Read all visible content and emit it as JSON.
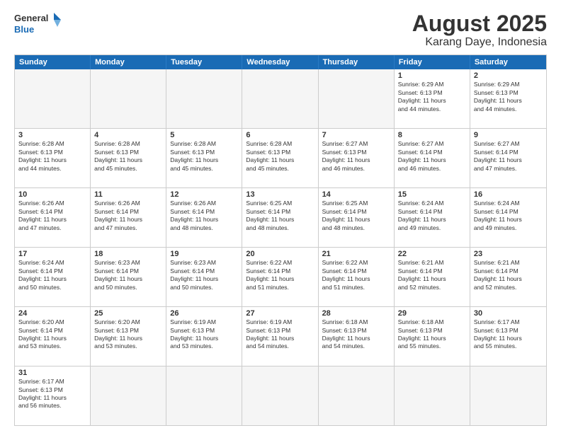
{
  "header": {
    "logo_general": "General",
    "logo_blue": "Blue",
    "title": "August 2025",
    "subtitle": "Karang Daye, Indonesia"
  },
  "weekdays": [
    "Sunday",
    "Monday",
    "Tuesday",
    "Wednesday",
    "Thursday",
    "Friday",
    "Saturday"
  ],
  "weeks": [
    [
      {
        "day": "",
        "info": ""
      },
      {
        "day": "",
        "info": ""
      },
      {
        "day": "",
        "info": ""
      },
      {
        "day": "",
        "info": ""
      },
      {
        "day": "",
        "info": ""
      },
      {
        "day": "1",
        "info": "Sunrise: 6:29 AM\nSunset: 6:13 PM\nDaylight: 11 hours\nand 44 minutes."
      },
      {
        "day": "2",
        "info": "Sunrise: 6:29 AM\nSunset: 6:13 PM\nDaylight: 11 hours\nand 44 minutes."
      }
    ],
    [
      {
        "day": "3",
        "info": "Sunrise: 6:28 AM\nSunset: 6:13 PM\nDaylight: 11 hours\nand 44 minutes."
      },
      {
        "day": "4",
        "info": "Sunrise: 6:28 AM\nSunset: 6:13 PM\nDaylight: 11 hours\nand 45 minutes."
      },
      {
        "day": "5",
        "info": "Sunrise: 6:28 AM\nSunset: 6:13 PM\nDaylight: 11 hours\nand 45 minutes."
      },
      {
        "day": "6",
        "info": "Sunrise: 6:28 AM\nSunset: 6:13 PM\nDaylight: 11 hours\nand 45 minutes."
      },
      {
        "day": "7",
        "info": "Sunrise: 6:27 AM\nSunset: 6:13 PM\nDaylight: 11 hours\nand 46 minutes."
      },
      {
        "day": "8",
        "info": "Sunrise: 6:27 AM\nSunset: 6:14 PM\nDaylight: 11 hours\nand 46 minutes."
      },
      {
        "day": "9",
        "info": "Sunrise: 6:27 AM\nSunset: 6:14 PM\nDaylight: 11 hours\nand 47 minutes."
      }
    ],
    [
      {
        "day": "10",
        "info": "Sunrise: 6:26 AM\nSunset: 6:14 PM\nDaylight: 11 hours\nand 47 minutes."
      },
      {
        "day": "11",
        "info": "Sunrise: 6:26 AM\nSunset: 6:14 PM\nDaylight: 11 hours\nand 47 minutes."
      },
      {
        "day": "12",
        "info": "Sunrise: 6:26 AM\nSunset: 6:14 PM\nDaylight: 11 hours\nand 48 minutes."
      },
      {
        "day": "13",
        "info": "Sunrise: 6:25 AM\nSunset: 6:14 PM\nDaylight: 11 hours\nand 48 minutes."
      },
      {
        "day": "14",
        "info": "Sunrise: 6:25 AM\nSunset: 6:14 PM\nDaylight: 11 hours\nand 48 minutes."
      },
      {
        "day": "15",
        "info": "Sunrise: 6:24 AM\nSunset: 6:14 PM\nDaylight: 11 hours\nand 49 minutes."
      },
      {
        "day": "16",
        "info": "Sunrise: 6:24 AM\nSunset: 6:14 PM\nDaylight: 11 hours\nand 49 minutes."
      }
    ],
    [
      {
        "day": "17",
        "info": "Sunrise: 6:24 AM\nSunset: 6:14 PM\nDaylight: 11 hours\nand 50 minutes."
      },
      {
        "day": "18",
        "info": "Sunrise: 6:23 AM\nSunset: 6:14 PM\nDaylight: 11 hours\nand 50 minutes."
      },
      {
        "day": "19",
        "info": "Sunrise: 6:23 AM\nSunset: 6:14 PM\nDaylight: 11 hours\nand 50 minutes."
      },
      {
        "day": "20",
        "info": "Sunrise: 6:22 AM\nSunset: 6:14 PM\nDaylight: 11 hours\nand 51 minutes."
      },
      {
        "day": "21",
        "info": "Sunrise: 6:22 AM\nSunset: 6:14 PM\nDaylight: 11 hours\nand 51 minutes."
      },
      {
        "day": "22",
        "info": "Sunrise: 6:21 AM\nSunset: 6:14 PM\nDaylight: 11 hours\nand 52 minutes."
      },
      {
        "day": "23",
        "info": "Sunrise: 6:21 AM\nSunset: 6:14 PM\nDaylight: 11 hours\nand 52 minutes."
      }
    ],
    [
      {
        "day": "24",
        "info": "Sunrise: 6:20 AM\nSunset: 6:14 PM\nDaylight: 11 hours\nand 53 minutes."
      },
      {
        "day": "25",
        "info": "Sunrise: 6:20 AM\nSunset: 6:13 PM\nDaylight: 11 hours\nand 53 minutes."
      },
      {
        "day": "26",
        "info": "Sunrise: 6:19 AM\nSunset: 6:13 PM\nDaylight: 11 hours\nand 53 minutes."
      },
      {
        "day": "27",
        "info": "Sunrise: 6:19 AM\nSunset: 6:13 PM\nDaylight: 11 hours\nand 54 minutes."
      },
      {
        "day": "28",
        "info": "Sunrise: 6:18 AM\nSunset: 6:13 PM\nDaylight: 11 hours\nand 54 minutes."
      },
      {
        "day": "29",
        "info": "Sunrise: 6:18 AM\nSunset: 6:13 PM\nDaylight: 11 hours\nand 55 minutes."
      },
      {
        "day": "30",
        "info": "Sunrise: 6:17 AM\nSunset: 6:13 PM\nDaylight: 11 hours\nand 55 minutes."
      }
    ],
    [
      {
        "day": "31",
        "info": "Sunrise: 6:17 AM\nSunset: 6:13 PM\nDaylight: 11 hours\nand 56 minutes."
      },
      {
        "day": "",
        "info": ""
      },
      {
        "day": "",
        "info": ""
      },
      {
        "day": "",
        "info": ""
      },
      {
        "day": "",
        "info": ""
      },
      {
        "day": "",
        "info": ""
      },
      {
        "day": "",
        "info": ""
      }
    ]
  ]
}
